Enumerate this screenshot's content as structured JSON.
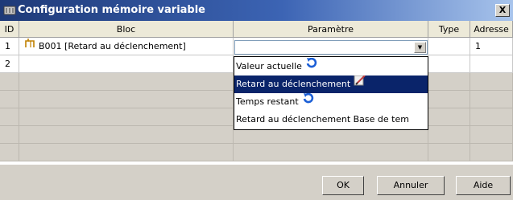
{
  "window": {
    "title": "Configuration mémoire variable",
    "close_label": "X"
  },
  "table": {
    "columns": [
      "ID",
      "Bloc",
      "Paramètre",
      "Type",
      "Adresse"
    ],
    "rows": [
      {
        "id": "1",
        "bloc": "B001 [Retard au déclenchement]",
        "parametre": "",
        "type": "",
        "adresse": "1"
      },
      {
        "id": "2",
        "bloc": "",
        "parametre": "",
        "type": "",
        "adresse": ""
      }
    ]
  },
  "dropdown": {
    "options": [
      {
        "label": "Valeur actuelle",
        "icon": "refresh-icon"
      },
      {
        "label": "Retard au déclenchement",
        "icon": "edit-icon"
      },
      {
        "label": "Temps restant",
        "icon": "refresh-icon"
      },
      {
        "label": "Retard au déclenchement Base de tem",
        "icon": ""
      }
    ],
    "selected_index": 1
  },
  "buttons": {
    "ok": "OK",
    "cancel": "Annuler",
    "help": "Aide"
  },
  "colors": {
    "title_gradient_start": "#1e3a78",
    "selection": "#0a246a",
    "refresh_icon": "#1c5fd6"
  }
}
